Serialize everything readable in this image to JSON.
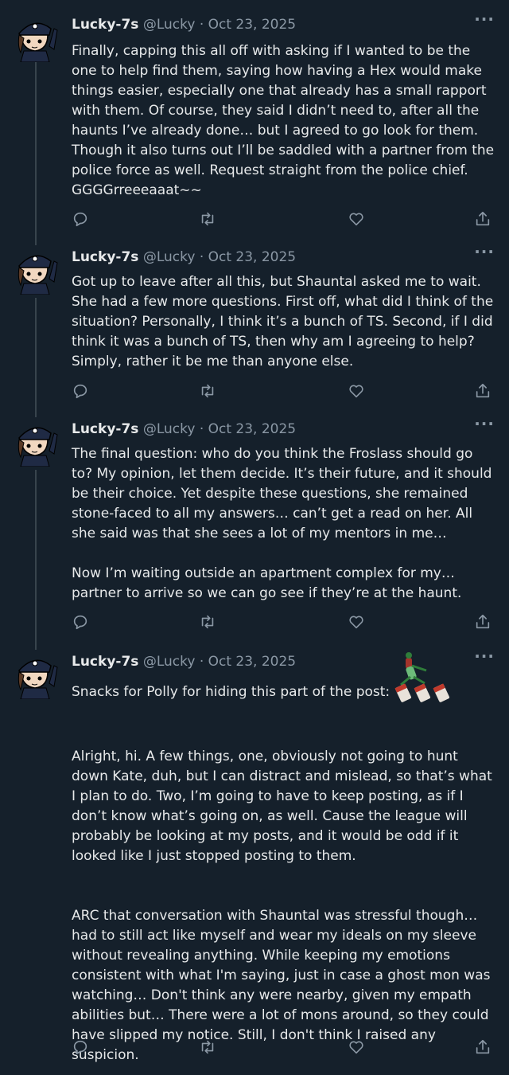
{
  "colors": {
    "background": "#15202b",
    "text": "#e7e9ea",
    "muted": "#8b98a5",
    "thread_line": "#38444d"
  },
  "tweets": [
    {
      "name": "Lucky-7s",
      "handle": "@Lucky",
      "separator": "·",
      "date": "Oct 23, 2025",
      "more": "···",
      "paragraphs": [
        "Finally, capping this all off with asking if I wanted to be the one to help find them, saying how having a Hex would make things easier, especially one that already has a small rapport with them. Of course, they said I didn’t need to, after all the haunts I’ve already done… but I agreed to go look for them. Though it also turns out I’ll be saddled with a partner from the police force as well. Request straight from the police chief. GGGGrreeeaaat~~"
      ]
    },
    {
      "name": "Lucky-7s",
      "handle": "@Lucky",
      "separator": "·",
      "date": "Oct 23, 2025",
      "more": "···",
      "paragraphs": [
        "Got up to leave after all this, but Shauntal asked me to wait. She had a few more questions. First off, what did I think of the situation? Personally, I think it’s a bunch of TS. Second, if I did think it was a bunch of TS, then why am I agreeing to help? Simply, rather it be me than anyone else."
      ]
    },
    {
      "name": "Lucky-7s",
      "handle": "@Lucky",
      "separator": "·",
      "date": "Oct 23, 2025",
      "more": "···",
      "paragraphs": [
        "The final question: who do you think the Froslass should go to? My opinion, let them decide. It’s their future, and it should be their choice. Yet despite these questions, she remained stone-faced to all my answers… can’t get a read on her. All she said was that she sees a lot of my mentors in me…",
        "Now I’m waiting outside an apartment complex for my… partner to arrive so we can go see if they’re at the haunt."
      ]
    },
    {
      "name": "Lucky-7s",
      "handle": "@Lucky",
      "separator": "·",
      "date": "Oct 23, 2025",
      "more": "···",
      "first_line": "Snacks for Polly for hiding this part of the post:",
      "paragraphs": [
        "Alright, hi. A few things, one, obviously not going to hunt down Kate, duh, but I can distract and mislead, so that’s what I plan to do. Two, I’m going to have to keep posting, as if I don’t know what’s going on, as well. Cause the league will probably be looking at my posts, and it would be odd if it looked like I just stopped posting to them.",
        "ARC that conversation with Shauntal was stressful though… had to still act like myself and wear my ideals on my sleeve without revealing anything. While keeping my emotions consistent with what I'm saying, just in case a ghost mon was watching… Don't think any were nearby, given my empath abilities but… There were a lot of mons around, so they could have slipped my notice. Still, I don't think I raised any suspicion."
      ]
    }
  ]
}
